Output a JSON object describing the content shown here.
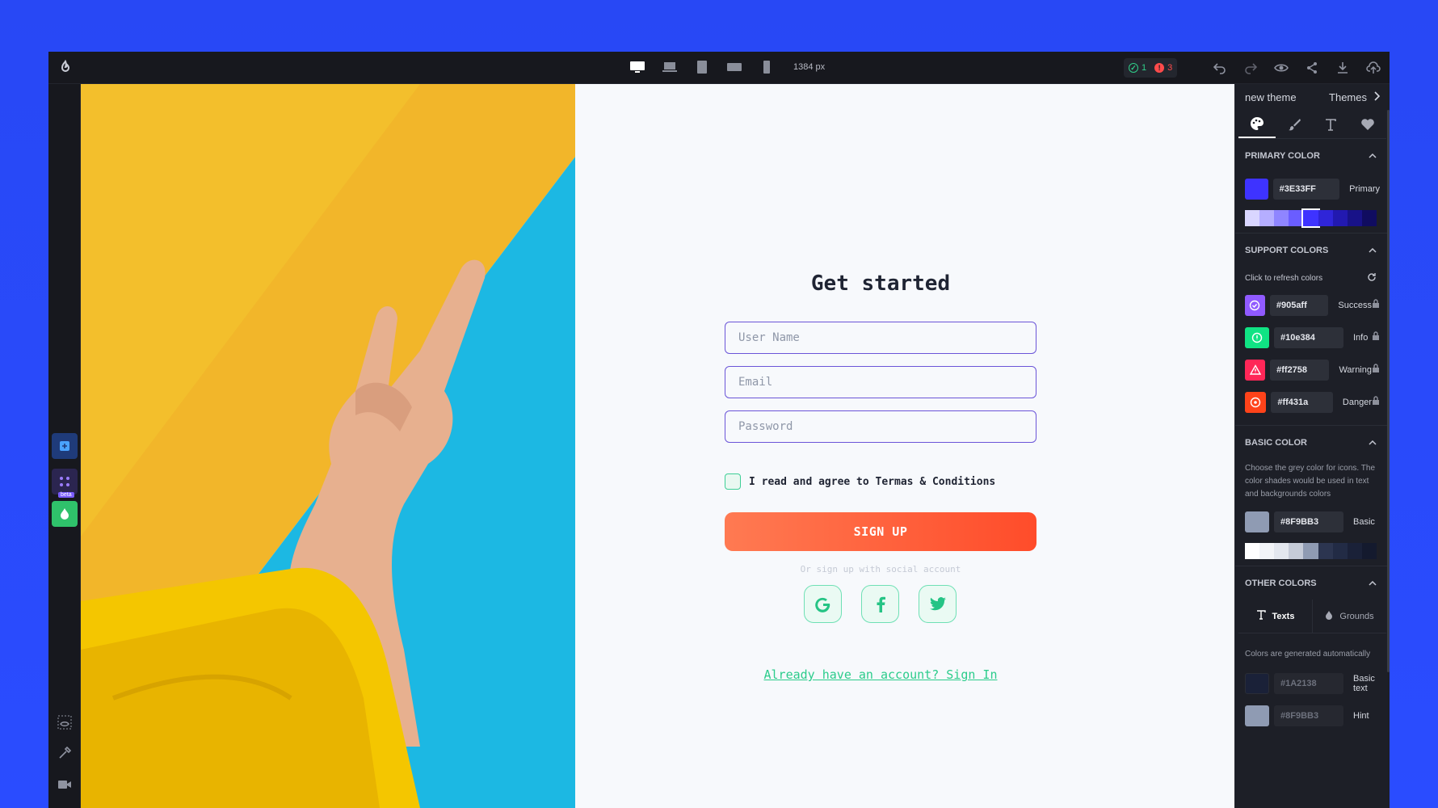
{
  "topbar": {
    "logo_icon": "builder-logo-icon",
    "devices": [
      "desktop-icon",
      "laptop-icon",
      "tablet-icon",
      "tablet-landscape-icon",
      "mobile-icon"
    ],
    "width_label": "1384 px",
    "checks_ok": "1",
    "checks_error": "3",
    "actions": [
      "undo-icon",
      "redo-icon",
      "preview-icon",
      "share-icon",
      "download-icon",
      "upload-icon"
    ]
  },
  "canvas": {
    "title": "Get started",
    "username_placeholder": "User Name",
    "email_placeholder": "Email",
    "password_placeholder": "Password",
    "agree_label": "I read and agree to Termas & Conditions",
    "signup_label": "SIGN UP",
    "social_hint": "Or sign up with social account",
    "signin_link": "Already have an account? Sign In"
  },
  "panel": {
    "theme_name": "new theme",
    "themes_label": "Themes",
    "primary": {
      "heading": "PRIMARY COLOR",
      "hex": "#3E33FF",
      "name": "Primary",
      "shades": [
        "#d9d6ff",
        "#b5aeff",
        "#8f85ff",
        "#6a5dff",
        "#3e33ff",
        "#2f25d8",
        "#2219b0",
        "#181288",
        "#100c60"
      ]
    },
    "support": {
      "heading": "SUPPORT COLORS",
      "refresh_label": "Click to refresh colors",
      "items": [
        {
          "hex": "#905aff",
          "name": "Success",
          "color": "#905aff"
        },
        {
          "hex": "#10e384",
          "name": "Info",
          "color": "#10e384"
        },
        {
          "hex": "#ff2758",
          "name": "Warning",
          "color": "#ff2758"
        },
        {
          "hex": "#ff431a",
          "name": "Danger",
          "color": "#ff431a"
        }
      ]
    },
    "basic": {
      "heading": "BASIC COLOR",
      "note": "Choose the grey color for icons. The color shades would be used in text and backgrounds colors",
      "hex": "#8F9BB3",
      "name": "Basic",
      "shades": [
        "#ffffff",
        "#f2f4f8",
        "#e3e7ef",
        "#c5cbd8",
        "#8f9bb3",
        "#2c3550",
        "#222b45",
        "#1a2138",
        "#141a2e"
      ]
    },
    "other": {
      "heading": "OTHER COLORS",
      "tab_texts": "Texts",
      "tab_grounds": "Grounds",
      "note": "Colors are generated automatically",
      "items": [
        {
          "hex": "#1A2138",
          "name": "Basic text",
          "color": "#1a2138"
        },
        {
          "hex": "#8F9BB3",
          "name": "Hint",
          "color": "#8f9bb3"
        }
      ]
    }
  }
}
